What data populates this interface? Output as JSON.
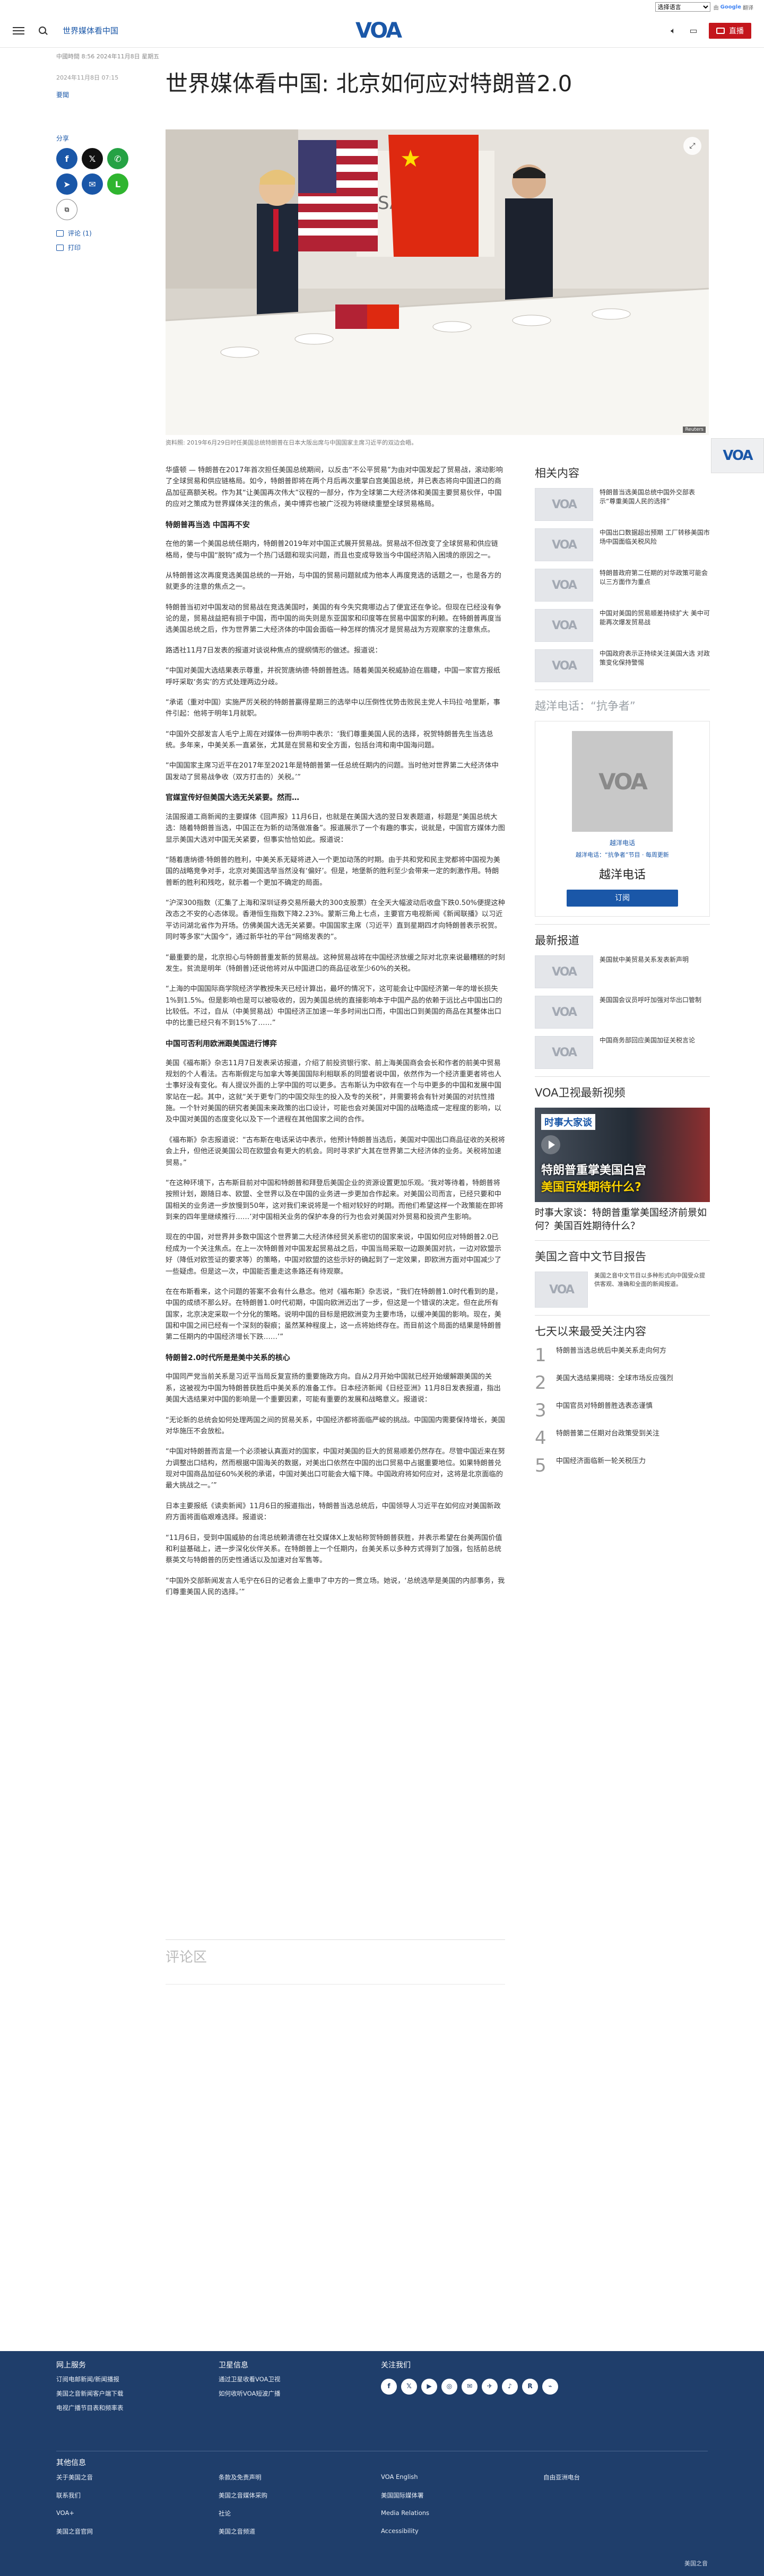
{
  "util": {
    "language_select": "选择语言",
    "translate_prefix": "由",
    "translate_brand": "Google",
    "translate_suffix": "翻译"
  },
  "header": {
    "section": "世界媒体看中国",
    "logo": "VOA",
    "live_label": "直播"
  },
  "article": {
    "meta": "中國時間 8:56 2024年11月8日 星期五",
    "date": "2024年11月8日 07:15",
    "category": "要聞",
    "title": "世界媒体看中国: 北京如何应对特朗普2.0",
    "caption": "资料照: 2019年6月29日时任美国总统特朗普在日本大阪出席与中国国家主席习近平的双边会晤。",
    "paragraphs": [
      {
        "type": "p",
        "text": "华盛顿 — 特朗普在2017年首次担任美国总统期间，以反击“不公平贸易”为由对中国发起了贸易战，滚动影响了全球贸易和供应链格局。如今，特朗普即将在两个月后再次重掌白宫美国总统，并已表态将向中国进口的商品加征高额关税。作为其“让美国再次伟大”议程的一部分，作为全球第二大经济体和美国主要贸易伙伴，中国的应对之策成为世界媒体关注的焦点，美中博弈也被广泛视为将继续重塑全球贸易格局。"
      },
      {
        "type": "h",
        "text": "特朗普再当选 中国再不安"
      },
      {
        "type": "p",
        "text": "在他的第一个美国总统任期内，特朗普2019年对中国正式展开贸易战。贸易战不但改变了全球贸易和供应链格局，使与中国“脱钩”成为一个热门话题和现实问题，而且也变成导致当今中国经济陷入困境的原因之一。"
      },
      {
        "type": "p",
        "text": "从特朗普这次再度竞选美国总统的一开始，与中国的贸易问题就成为他本人再度竞选的话题之一，也是各方的就更多的注意的焦点之一。"
      },
      {
        "type": "p",
        "text": "特朗普当初对中国发动的贸易战在竞选美国时，美国的有今失究竟哪边占了便宜还在争论。但现在已经没有争论的是，贸易战益把有损于中国，而中国的尚失则是东亚国家和印度等在贸易中国家的利赖。在特朗普再度当选美国总统之后，作为世界第二大经济体的中国会面临一种怎样的情况才是贸易战为方观察家的注意焦点。"
      },
      {
        "type": "p",
        "text": "路透社11月7日发表的报道对谈说种焦点的提纲情形的做述。报道说："
      },
      {
        "type": "p",
        "text": "“中国对美国大选结果表示尊重，并祝贺唐纳德·特朗普胜选。随着美国关税威胁迫在眉睫，中国一家官方报纸呼吁采取‘务实’的方式处理两边分歧。"
      },
      {
        "type": "p",
        "text": "“承诺（重对中国）实施严厉关税的特朗普赢得星期三的选举中以压倒性优势击败民主党人卡玛拉·哈里斯，事件引起：他将于明年1月就职。"
      },
      {
        "type": "p",
        "text": "“中国外交部发言人毛宁上周在对媒体一份声明中表示：‘我们尊重美国人民的选择，祝贺特朗普先生当选总统。多年来，中美关系一直紧张，尤其是在贸易和安全方面，包括台湾和南中国海问题。"
      },
      {
        "type": "p",
        "text": "“中国国家主席习近平在2017年至2021年是特朗普第一任总统任期内的问题。当时他对世界第二大经济体中国发动了贸易战争收（双方打击的）关税。’”"
      },
      {
        "type": "h",
        "text": "官媒宣传好但美国大选无关紧要。然而…"
      },
      {
        "type": "p",
        "text": "法国报道工商新闻的主要媒体《回声报》11月6日，也就是在美国大选的翌日发表题道，标题是“美国总统大选：随着特朗普当选，中国正在为新的动荡做准备”。报道展示了一个有趣的事实，说就是，中国官方媒体力图显示美国大选对中国无关紧要，但事实恰恰如此。报道说："
      },
      {
        "type": "p",
        "text": "“随着唐纳德·特朗普的胜利，中美关系无疑将进入一个更加动荡的时期。由于共和党和民主党都将中国视为美国的战略竞争对手，北京对美国选举当然没有‘偏好’。但是，地堡新的胜利至少会带来一定的刺激作用。特朗普断的胜利和残吃，就示着一个更加不确定的局面。"
      },
      {
        "type": "p",
        "text": "“沪深300指数（汇集了上海和深圳证券交易所最大的300支股票）在全天大幅波动后收盘下跌0.50%便提这种改态之不安的心态体现。香港恒生指数下降2.23%。蒙斯三角上七点，主要官方电视新闻《新闻联播》以习近平访问湖北省作为开场。仿佛美国大选无关紧要。中国国家主席（习近平）直到星期四才向特朗普表示祝贺。同时等多家”大国今“，通过新华社的平台“网络发表的”。"
      },
      {
        "type": "p",
        "text": "“最重要的是，北京担心与特朗普重发新的贸易战。这种贸易战将在中国经济放缓之际对北京来说最糟糕的时刻发生。贫流是明年（特朗普)还说他将对从中国进口的商品征收至少60%的关税。"
      },
      {
        "type": "p",
        "text": "“上海的中国国际商学院经济学教授朱天已经计算出，最坏的情况下，这可能会让中国经济第一年的增长损失1%到1.5%。但是影响也是可以被吸收的，因为美国总统的直接影响本于中国产品的依赖于远比占中国出口的比较低。不过，自从（中美贸易战）中国经济正加速一年多时间出口而，中国出口到美国的商品在其整体出口中的比重已经只有不到15%了……”"
      },
      {
        "type": "h",
        "text": "中国可否利用欧洲跟美国进行博弈"
      },
      {
        "type": "p",
        "text": "美国《福布斯》杂志11月7日发表采访报道，介绍了前投资银行家、前上海美国商会会长和作者的前美中贸易规划的个人看法。古布斯假定与加拿大等美国国际利相联系的同盟者说中国，依然作为一个经济重更者将也人士事好没有变化。有人提议外面的上学中国的可以更多。古布斯认为中欧有在一个与中更多的中国和发展中国家站在一起。其中，这就“关于更专门的中国交际生的投入及专的关税”，并需要将会有针对美国的对抗性措施。一个针对美国的研究者美国未来政策的出口设计，可能也会对美国对中国的战略造成一定程度的影响，以及中国对美国的态度变化以及下一个进程在其他国家之间的合作。"
      },
      {
        "type": "p",
        "text": "《福布斯》杂志报道说：“古布斯在电话采访中表示，他预计特朗普当选后，美国对中国出口商品征收的关税将会上升，但他还说美国公司在欧盟会有更大的机会。同时寻求扩大其在世界第二大经济体的业务。关税将加速贸易。”"
      },
      {
        "type": "p",
        "text": "“在这种环境下，古布斯目前对中国和特朗普和拜登后美国企业的资源设置更加乐观。‘我对等待着，特朗普将按照计划，跟随日本、欧盟、全世界以及在中国的业务进一步更加合作起来。对美国公司而言，已经只要和中国相关的业务进一步放慢到50年，这对我们来说将是一个相对较好的时期。而他们希望这样一个政策能在即将到来的四年里继续推行……’对中国相关业务的保护本身的行为也会对美国对外贸易和投资产生影响。"
      },
      {
        "type": "p",
        "text": "现在的中国，对世界并多数中国这个世界第二大经济体经贸关系密切的国家来说，中国如何应对特朗普2.0已经成为一个关注焦点。在上一次特朗普对中国发起贸易战之后，中国当局采取一边跟美国对抗，一边对欧盟示好（降低对欧签证的要求等）的策略，中国对欧盟的这些示好的确起到了一定效果，即欧洲方面对中国减少了一些疑虑。但是这一次，中国能否重走这条路还有待观察。"
      },
      {
        "type": "p",
        "text": "在在布斯看来，这个问题的答案不会有什么悬念。他对《福布斯》杂志说，“我们在特朗普1.0时代看到的是，中国的成绩不那么好。在特朗普1.0时代初期，中国向欧洲迈出了一步，但这是一个错误的决定。但在此所有国家，北京决定采取一个分化的策略。说明中国的目标是把欧洲变为主要市场，以缓冲美国的影响。现在，美国和中国之间已经有一个深刻的裂痕；虽然某种程度上，这一点将始终存在。而目前这个局面的结果是特朗普第二任期内的中国经济增长下跌……’”"
      },
      {
        "type": "h",
        "text": "特朗普2.0时代所是是美中关系的核心"
      },
      {
        "type": "p",
        "text": "中国同严党当前关系是习近平当局反复宣扬的重要施政方向。自从2月开始中国就已经开始缓解跟美国的关系，这被视为中国为特朗普获胜后中美关系的准备工作。日本经济新闻《日经亚洲》11月8日发表报道，指出美国大选结果对中国的影响是一个重要因素，可能有重要的发展和战略意义。报道说："
      },
      {
        "type": "p",
        "text": "“无论新的总统会如何处理两国之间的贸易关系，中国经济都将面临严峻的挑战。中国国内需要保持增长，美国对华施压不会放松。"
      },
      {
        "type": "p",
        "text": "“中国对特朗普而言是一个必须被认真面对的国家，中国对美国的巨大的贸易顺差仍然存在。尽管中国近来在努力调整出口结构，然而根据中国海关的数据，对美出口依然在中国的出口贸易中占据重要地位。如果特朗普兑现对中国商品加征60%关税的承诺，中国对美出口可能会大幅下降。中国政府将如何应对，这将是北京面临的最大挑战之一。’”"
      },
      {
        "type": "p",
        "text": "日本主要报纸《读卖新闻》11月6日的报道指出，特朗普当选总统后，中国领导人习近平在如何应对美国新政府方面将面临艰难选择。报道说："
      },
      {
        "type": "p",
        "text": "“11月6日，受到中国威胁的台湾总统赖清德在社交媒体X上发帖称贺特朗普获胜，并表示希望在台美两国价值和利益基础上，进一步深化伙伴关系。在特朗普上一个任期内，台美关系以多种方式得到了加强，包括前总统蔡英文与特朗普的历史性通话以及加速对台军售等。"
      },
      {
        "type": "p",
        "text": "“中国外交部新闻发言人毛宁在6日的记者会上重申了中方的一贯立场。她说，‘总统选举是美国的内部事务，我们尊重美国人民的选择。’”"
      }
    ],
    "comments_heading": "评论区"
  },
  "share": {
    "label": "分享",
    "buttons": [
      {
        "name": "facebook",
        "glyph": "f"
      },
      {
        "name": "x",
        "glyph": "𝕏"
      },
      {
        "name": "whatsapp",
        "glyph": "✆"
      },
      {
        "name": "telegram",
        "glyph": "➤"
      },
      {
        "name": "email",
        "glyph": "✉"
      },
      {
        "name": "line",
        "glyph": "L"
      },
      {
        "name": "copy-link",
        "glyph": "⧉"
      }
    ],
    "comments_link": "评论 (1)",
    "print_link": "打印"
  },
  "sidebar": {
    "related_title": "相关内容",
    "related": [
      "特朗普当选美国总统中国外交部表示“尊重美国人民的选择”",
      "中国出口数据超出预期 工厂转移美国市场中国面临关税风险",
      "特朗普政府第二任期的对华政策可能会以三方面作为重点",
      "中国对美国的贸易顺差持续扩大 美中可能再次爆发贸易战",
      "中国政府表示正持续关注美国大选 对政策变化保持警惕"
    ],
    "subscribe_title": "越洋电话：“抗争者”",
    "subscribe_img": "VOA",
    "subscribe_line1": "越洋电话",
    "subscribe_line2": "越洋电话：“抗争者”节目 · 每周更新",
    "subscribe_name": "越洋电话",
    "subscribe_button": "订阅",
    "latest_title": "最新报道",
    "latest": [
      "美国就中美贸易关系发表新声明",
      "美国国会议员呼吁加强对华出口管制",
      "中国商务部回应美国加征关税言论"
    ],
    "video_title": "VOA卫视最新视频",
    "video_tag": "时事大家谈",
    "video_line1": "特朗普重掌美国白宫",
    "video_line2": "美国百姓期待什么?",
    "video_caption": "时事大家谈：特朗普重掌美国经济前景如何？美国百姓期待什么？",
    "report_title": "美国之音中文节目报告",
    "report_text": "美国之音中文节目以多种形式向中国受众提供客观、准确和全面的新闻报道。",
    "popular_title": "七天以来最受关注内容",
    "popular": [
      "特朗普当选总统后中美关系走向何方",
      "美国大选结果揭晓：全球市场反应强烈",
      "中国官员对特朗普胜选表态谨慎",
      "特朗普第二任期对台政策受到关注",
      "中国经济面临新一轮关税压力"
    ]
  },
  "footer": {
    "col1_title": "网上服务",
    "col1": [
      "订阅电邮新闻/新闻播报",
      "美国之音新闻客户端下载",
      "电视广播节目表和频率表"
    ],
    "col2_title": "卫星信息",
    "col2": [
      "通过卫星收看VOA卫视",
      "如何收听VOA短波广播"
    ],
    "col3_title": "关注我们",
    "social": [
      "f",
      "𝕏",
      "▶",
      "◎",
      "✉",
      "✈",
      "♪",
      "R",
      "⌁"
    ],
    "other_title": "其他信息",
    "grid": [
      [
        "关于美国之音",
        "条款及免责声明",
        "VOA English",
        "自由亚洲电台"
      ],
      [
        "联系我们",
        "美国之音媒体采购",
        "美国国际媒体署",
        ""
      ],
      [
        "VOA+",
        "社论",
        "Media Relations",
        ""
      ],
      [
        "美国之音官网",
        "美国之音频道",
        "Accessibility",
        ""
      ]
    ],
    "copyright": "美国之音"
  }
}
